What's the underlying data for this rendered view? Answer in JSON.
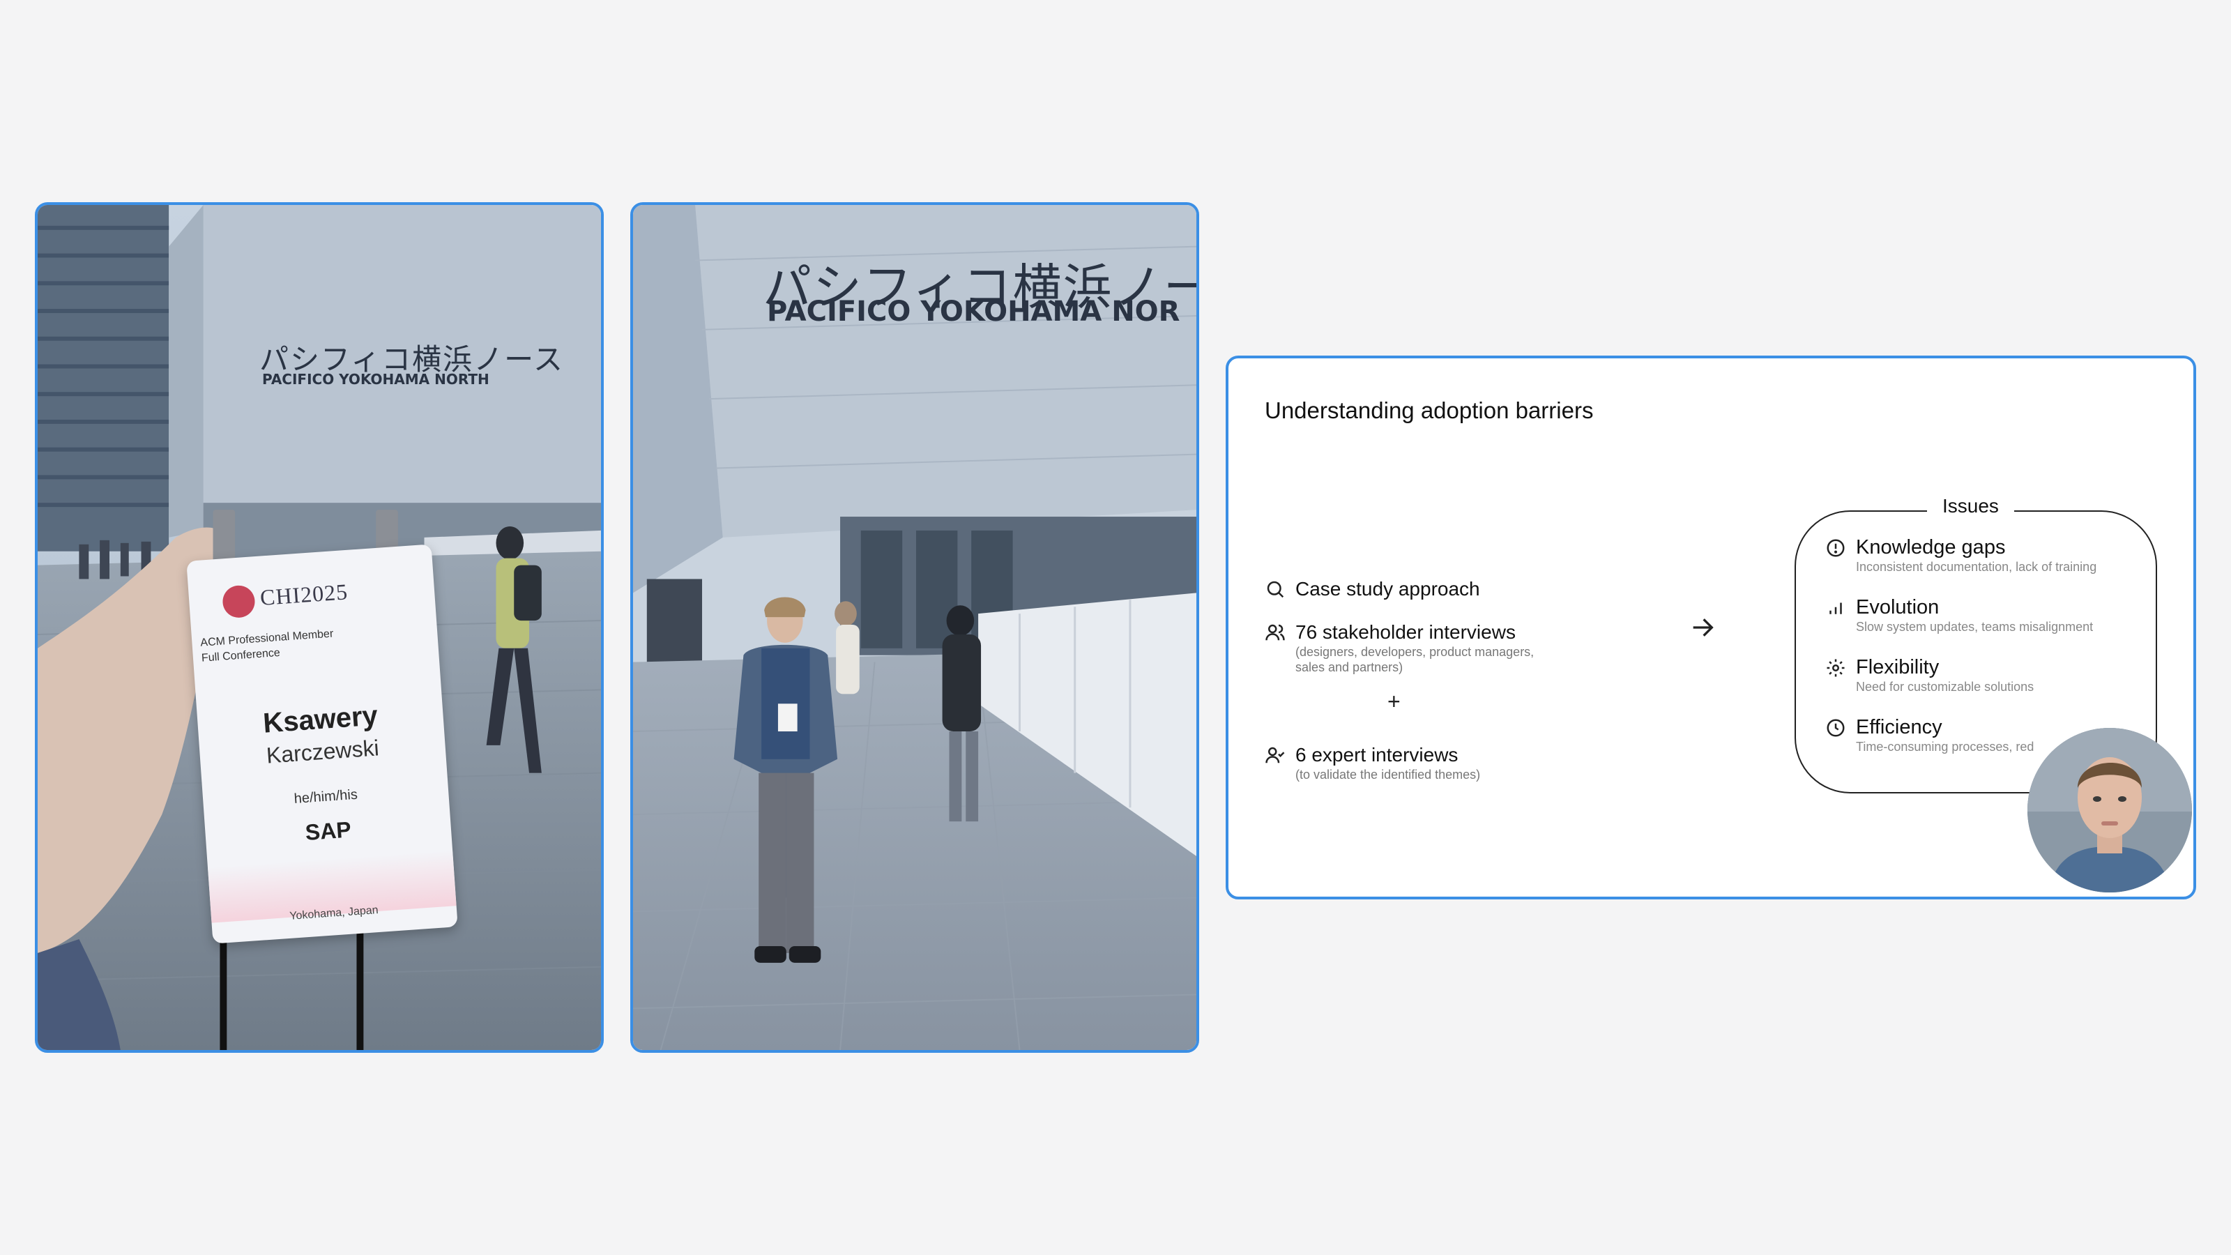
{
  "photo1": {
    "sign_jp": "パシフィコ横浜ノース",
    "sign_en": "PACIFICO YOKOHAMA NORTH",
    "badge": {
      "logo": "CHI2025",
      "membership": "ACM Professional Member",
      "registration": "Full Conference",
      "first_name": "Ksawery",
      "last_name": "Karczewski",
      "pronouns": "he/him/his",
      "organization": "SAP",
      "location": "Yokohama, Japan"
    }
  },
  "photo2": {
    "sign_jp": "パシフィコ横浜ノー",
    "sign_en": "PACIFICO YOKOHAMA NOR"
  },
  "slide": {
    "title": "Understanding adoption barriers",
    "approach": [
      {
        "icon": "search-icon",
        "label": "Case study approach",
        "detail": ""
      },
      {
        "icon": "users-icon",
        "label": "76 stakeholder interviews",
        "detail_lines": [
          "(designers, developers, product managers,",
          "sales and partners)"
        ]
      },
      {
        "icon": "user-check-icon",
        "label": "6 expert interviews",
        "detail_lines": [
          "(to validate the identified themes)"
        ]
      }
    ],
    "plus": "+",
    "issues_title": "Issues",
    "issues": [
      {
        "icon": "alert-circle-icon",
        "label": "Knowledge gaps",
        "detail": "Inconsistent documentation, lack of training"
      },
      {
        "icon": "bar-chart-icon",
        "label": "Evolution",
        "detail": "Slow system updates, teams misalignment"
      },
      {
        "icon": "gear-icon",
        "label": "Flexibility",
        "detail": "Need for customizable solutions"
      },
      {
        "icon": "clock-icon",
        "label": "Efficiency",
        "detail": "Time-consuming processes, red"
      }
    ]
  },
  "colors": {
    "card_border": "#3b8fe5",
    "background": "#f4f4f5"
  }
}
